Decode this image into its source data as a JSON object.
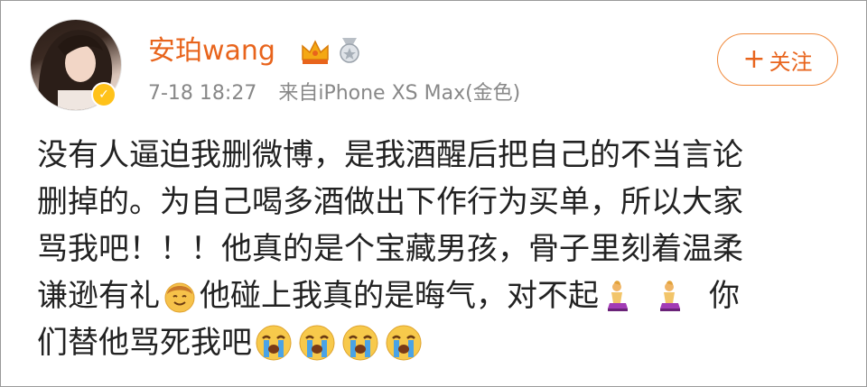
{
  "user": {
    "name": "安珀wang",
    "badge_icon": "vip-check-icon",
    "crown_icon": "crown-icon",
    "medal_icon": "medal-icon",
    "vip_color": "#ffc21a"
  },
  "meta": {
    "time": "7-18 18:27",
    "source": "来自iPhone XS Max(金色)"
  },
  "follow_button": {
    "plus": "+",
    "label": "关注"
  },
  "post": {
    "line1": "没有人逼迫我删微博，是我酒醒后把自己的不当言论",
    "line2": "删掉的。为自己喝多酒做出下作行为买单，所以大家",
    "line3": "骂我吧！！！他真的是个宝藏男孩，骨子里刻着温柔",
    "line4a": "谦逊有礼",
    "line4b": "他碰上我真的是晦气，对不起",
    "line4c": "你",
    "line5": "们替他骂死我吧",
    "emojis": [
      "smiling-face-icon",
      "kneeling-person-icon",
      "kneeling-person-icon",
      "crying-face-icon",
      "crying-face-icon",
      "crying-face-icon",
      "crying-face-icon"
    ]
  },
  "colors": {
    "username": "#e8641c",
    "meta": "#888888",
    "text": "#222222",
    "follow_border": "#f08a3c"
  }
}
